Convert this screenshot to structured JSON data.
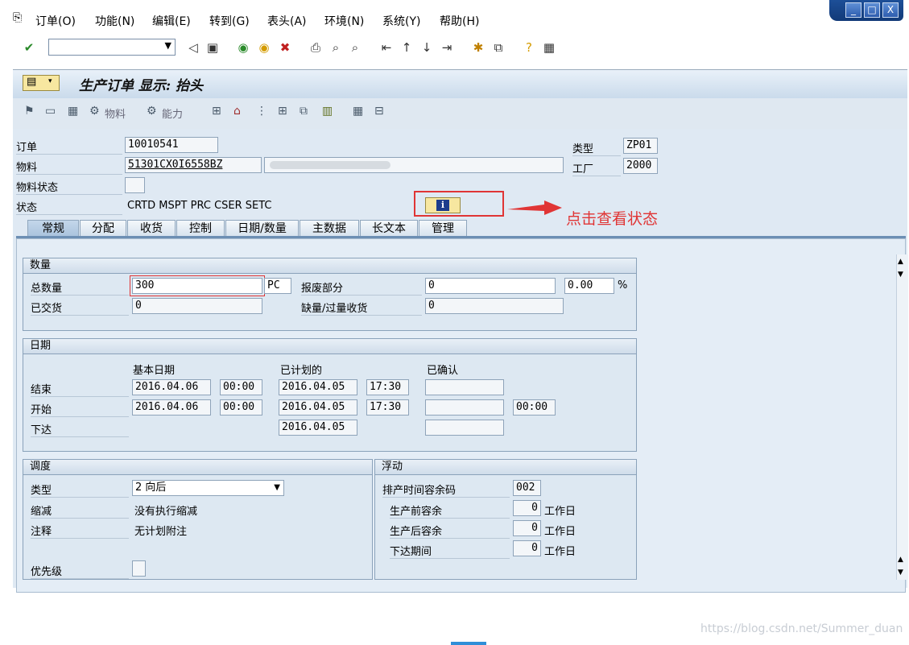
{
  "menu": [
    "订单(O)",
    "功能(N)",
    "编辑(E)",
    "转到(G)",
    "表头(A)",
    "环境(N)",
    "系统(Y)",
    "帮助(H)"
  ],
  "window_controls": [
    "_",
    "□",
    "X"
  ],
  "command_field": "",
  "title": "生产订单 显示: 抬头",
  "app_toolbar": {
    "material_btn": "物料",
    "capacity_btn": "能力"
  },
  "header": {
    "order_label": "订单",
    "order_value": "10010541",
    "material_label": "物料",
    "material_value": "51301CX0I6558BZ",
    "material_status_label": "物料状态",
    "status_label": "状态",
    "status_value": "CRTD MSPT PRC  CSER SETC",
    "type_label": "类型",
    "type_value": "ZP01",
    "plant_label": "工厂",
    "plant_value": "2000",
    "info_icon": "info-icon"
  },
  "annotation": "点击查看状态",
  "tabs": [
    "常规",
    "分配",
    "收货",
    "控制",
    "日期/数量",
    "主数据",
    "长文本",
    "管理"
  ],
  "quantity": {
    "title": "数量",
    "total_label": "总数量",
    "total_value": "300",
    "unit": "PC",
    "scrap_label": "报废部分",
    "scrap_value": "0",
    "scrap_pct": "0.00",
    "pct_sign": "%",
    "delivered_label": "已交货",
    "delivered_value": "0",
    "short_label": "缺量/过量收货",
    "short_value": "0"
  },
  "dates": {
    "title": "日期",
    "basic_label": "基本日期",
    "scheduled_label": "已计划的",
    "confirmed_label": "已确认",
    "end_label": "结束",
    "end_basic_date": "2016.04.06",
    "end_basic_time": "00:00",
    "end_sched_date": "2016.04.05",
    "end_sched_time": "17:30",
    "start_label": "开始",
    "start_basic_date": "2016.04.06",
    "start_basic_time": "00:00",
    "start_sched_date": "2016.04.05",
    "start_sched_time": "17:30",
    "start_conf_time": "00:00",
    "release_label": "下达",
    "release_sched_date": "2016.04.05"
  },
  "scheduling": {
    "title": "调度",
    "type_label": "类型",
    "type_value": "2 向后",
    "reduce_label": "缩减",
    "reduce_value": "没有执行缩减",
    "note_label": "注释",
    "note_value": "无计划附注",
    "priority_label": "优先级"
  },
  "float": {
    "title": "浮动",
    "sm_label": "排产时间容余码",
    "sm_value": "002",
    "before_label": "生产前容余",
    "before_value": "0",
    "before_unit": "工作日",
    "after_label": "生产后容余",
    "after_value": "0",
    "after_unit": "工作日",
    "release_label": "下达期间",
    "release_value": "0",
    "release_unit": "工作日"
  },
  "watermark": "https://blog.csdn.net/Summer_duan"
}
